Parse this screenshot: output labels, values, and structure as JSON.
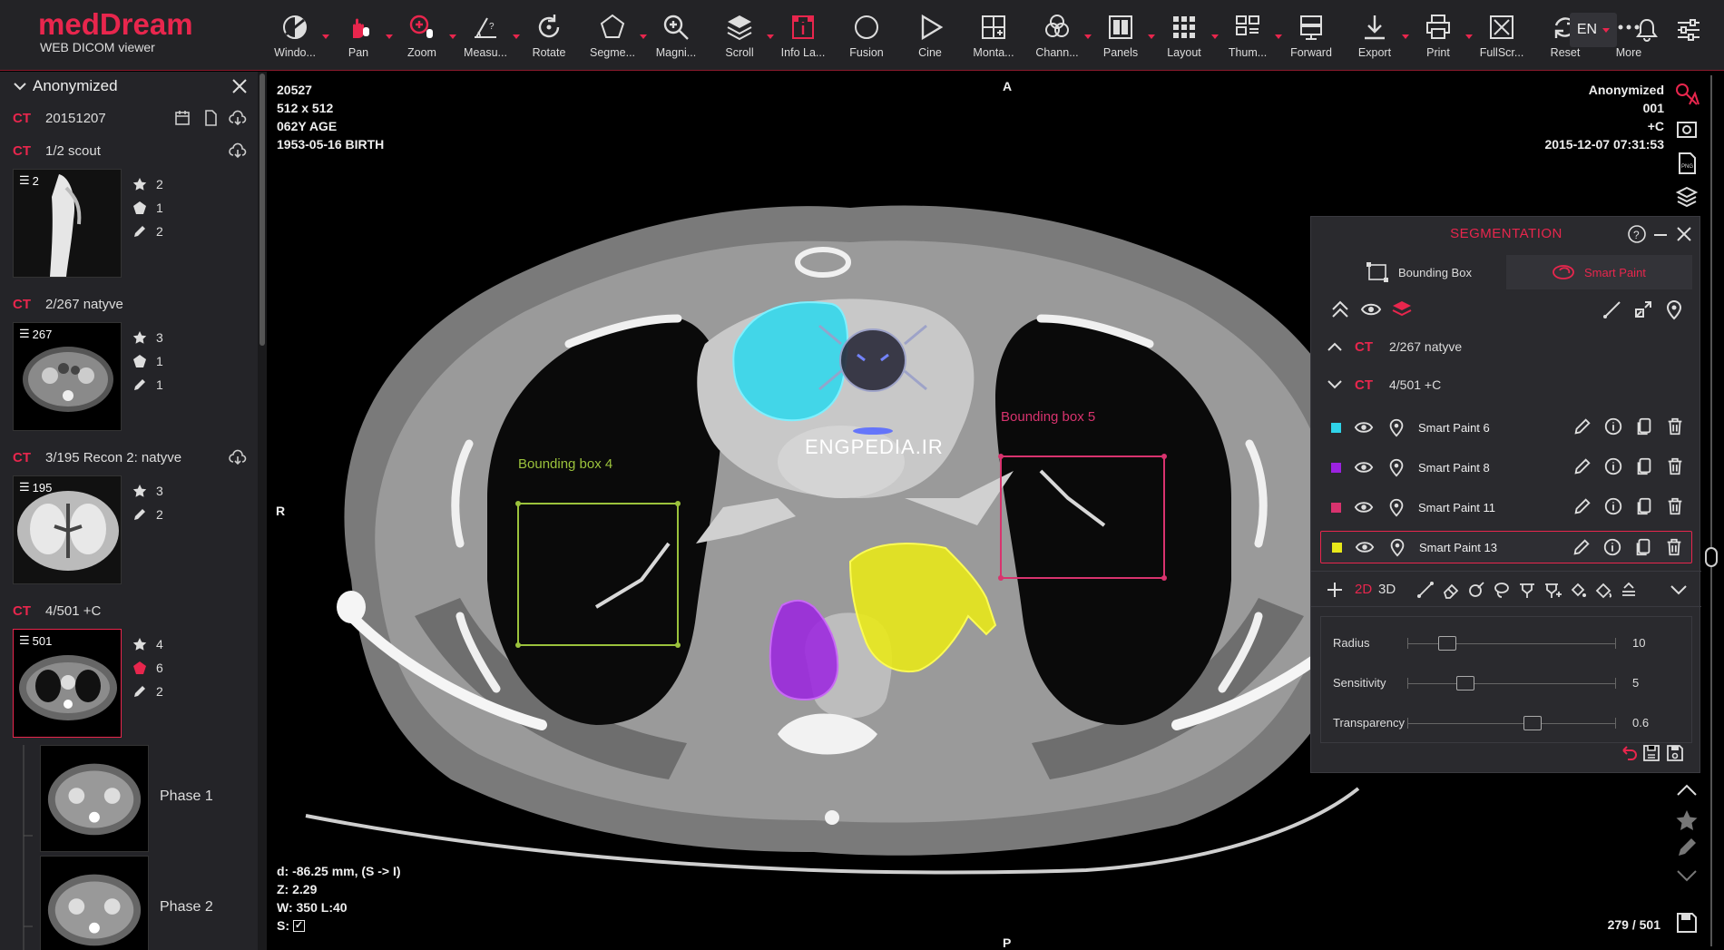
{
  "app": {
    "brand": "medDream",
    "subtitle": "WEB DICOM viewer"
  },
  "toolbar": {
    "tools": [
      {
        "label": "Windo...",
        "icon": "window-level-icon",
        "caret": true
      },
      {
        "label": "Pan",
        "icon": "pan-icon",
        "caret": true
      },
      {
        "label": "Zoom",
        "icon": "zoom-icon",
        "caret": true
      },
      {
        "label": "Measu...",
        "icon": "measure-icon",
        "caret": true
      },
      {
        "label": "Rotate",
        "icon": "rotate-icon",
        "caret": false
      },
      {
        "label": "Segme...",
        "icon": "segmentation-icon",
        "caret": true
      },
      {
        "label": "Magni...",
        "icon": "magnifier-icon",
        "caret": false
      },
      {
        "label": "Scroll",
        "icon": "scroll-icon",
        "caret": true
      },
      {
        "label": "Info La...",
        "icon": "info-label-icon",
        "caret": false
      },
      {
        "label": "Fusion",
        "icon": "fusion-icon",
        "caret": false
      },
      {
        "label": "Cine",
        "icon": "cine-icon",
        "caret": false
      },
      {
        "label": "Monta...",
        "icon": "montage-icon",
        "caret": false
      },
      {
        "label": "Chann...",
        "icon": "channels-icon",
        "caret": true
      },
      {
        "label": "Panels",
        "icon": "panels-icon",
        "caret": true
      },
      {
        "label": "Layout",
        "icon": "layout-icon",
        "caret": true
      },
      {
        "label": "Thum...",
        "icon": "thumbnails-icon",
        "caret": true
      },
      {
        "label": "Forward",
        "icon": "forward-icon",
        "caret": false
      },
      {
        "label": "Export",
        "icon": "export-icon",
        "caret": true
      },
      {
        "label": "Print",
        "icon": "print-icon",
        "caret": true
      },
      {
        "label": "FullScr...",
        "icon": "fullscreen-icon",
        "caret": false
      },
      {
        "label": "Reset",
        "icon": "reset-icon",
        "caret": true
      },
      {
        "label": "More",
        "icon": "more-icon",
        "caret": false
      }
    ],
    "language": "EN"
  },
  "sidebar": {
    "patient": "Anonymized",
    "study": {
      "modality": "CT",
      "date": "20151207"
    },
    "series": [
      {
        "modality": "CT",
        "name": "1/2 scout",
        "count": "2",
        "stars": "2",
        "shapes": "1",
        "edits": "2"
      },
      {
        "modality": "CT",
        "name": "2/267 natyve",
        "count": "267",
        "stars": "3",
        "shapes": "1",
        "edits": "1"
      },
      {
        "modality": "CT",
        "name": "3/195 Recon 2: natyve",
        "count": "195",
        "stars": "3",
        "edits": "2"
      },
      {
        "modality": "CT",
        "name": "4/501 +C",
        "count": "501",
        "stars": "4",
        "shapes": "6",
        "edits": "2"
      }
    ],
    "phases": [
      "Phase 1",
      "Phase 2"
    ]
  },
  "viewport": {
    "top_left": [
      "20527",
      "512 x 512",
      "062Y AGE",
      "1953-05-16 BIRTH"
    ],
    "top_right": [
      "Anonymized",
      "001",
      "+C",
      "2015-12-07 07:31:53"
    ],
    "orientation": {
      "top": "A",
      "left": "R",
      "bottom": "P"
    },
    "bottom_left": {
      "distance": "d: -86.25 mm, (S -> I)",
      "z": "Z: 2.29",
      "window": "W: 350 L:40",
      "sync": "S:"
    },
    "frame": "279 / 501",
    "annotations": [
      {
        "label": "Bounding box 4",
        "color": "#9bc23c"
      },
      {
        "label": "Bounding box 5",
        "color": "#d8336e"
      }
    ],
    "watermark": "ENGPEDIA.IR"
  },
  "segmentation": {
    "title": "SEGMENTATION",
    "tabs": [
      "Bounding Box",
      "Smart Paint"
    ],
    "series": [
      {
        "modality": "CT",
        "name": "2/267 natyve"
      },
      {
        "modality": "CT",
        "name": "4/501 +C"
      }
    ],
    "layers": [
      {
        "name": "Smart Paint 6",
        "color": "#2fd3e8"
      },
      {
        "name": "Smart Paint 8",
        "color": "#9b22e0"
      },
      {
        "name": "Smart Paint 11",
        "color": "#d8336e"
      },
      {
        "name": "Smart Paint 13",
        "color": "#e8e81a"
      }
    ],
    "mode_2d": "2D",
    "mode_3d": "3D",
    "sliders": [
      {
        "label": "Radius",
        "value": "10",
        "fraction": 0.19
      },
      {
        "label": "Sensitivity",
        "value": "5",
        "fraction": 0.28
      },
      {
        "label": "Transparency",
        "value": "0.6",
        "fraction": 0.6
      }
    ]
  }
}
